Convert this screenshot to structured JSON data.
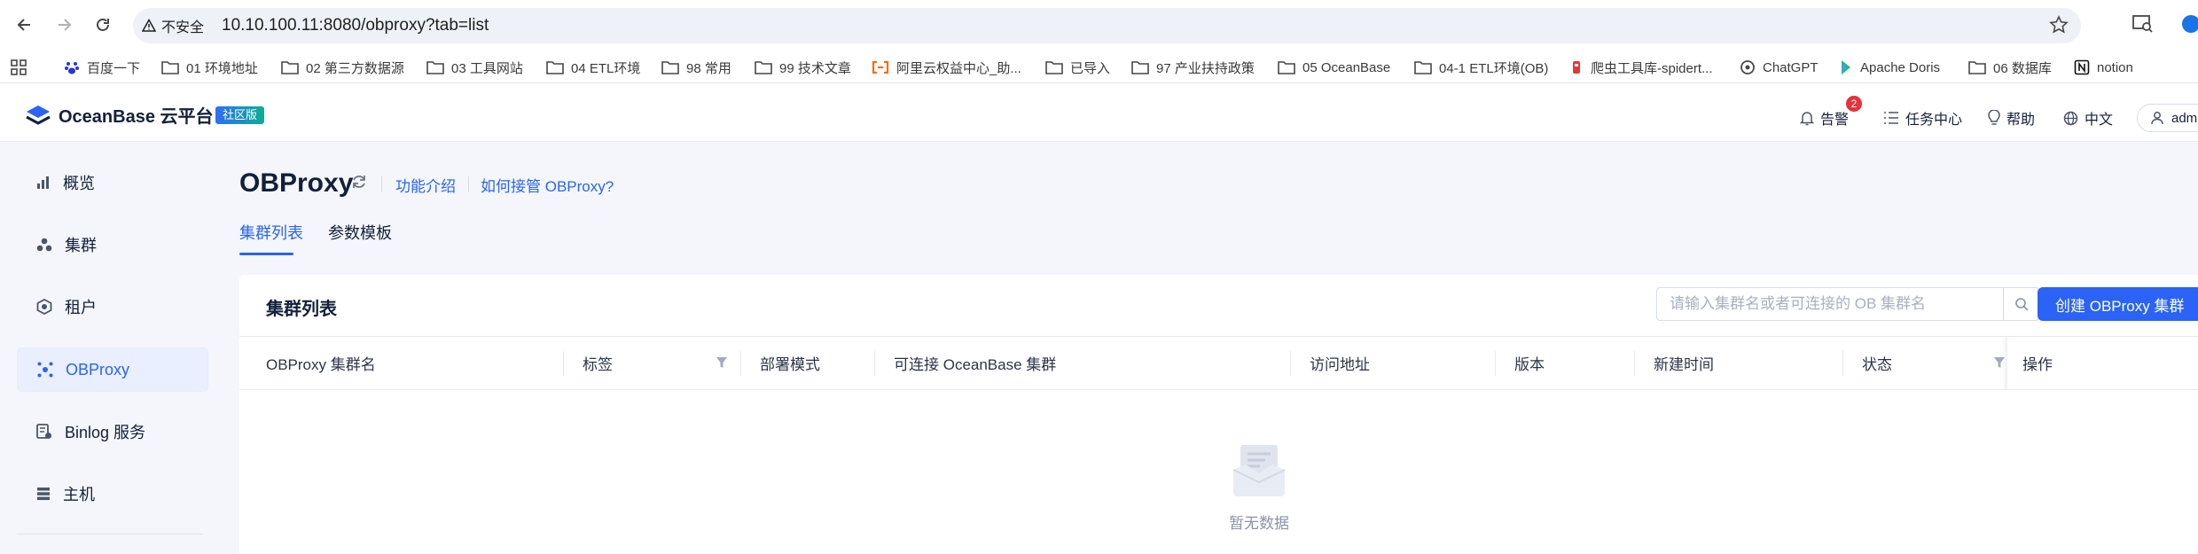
{
  "browser": {
    "security_label": "不安全",
    "url": "10.10.100.11:8080/obproxy?tab=list"
  },
  "bookmarks": [
    {
      "label": "百度一下",
      "icon": "baidu-icon"
    },
    {
      "label": "01 环境地址",
      "icon": "folder-icon"
    },
    {
      "label": "02 第三方数据源",
      "icon": "folder-icon"
    },
    {
      "label": "03 工具网站",
      "icon": "folder-icon"
    },
    {
      "label": "04 ETL环境",
      "icon": "folder-icon"
    },
    {
      "label": "98 常用",
      "icon": "folder-icon"
    },
    {
      "label": "99 技术文章",
      "icon": "folder-icon"
    },
    {
      "label": "阿里云权益中心_助...",
      "icon": "aliyun-icon"
    },
    {
      "label": "已导入",
      "icon": "folder-icon"
    },
    {
      "label": "97 产业扶持政策",
      "icon": "folder-icon"
    },
    {
      "label": "05 OceanBase",
      "icon": "folder-icon"
    },
    {
      "label": "04-1 ETL环境(OB)",
      "icon": "folder-icon"
    },
    {
      "label": "爬虫工具库-spidert...",
      "icon": "spider-icon"
    },
    {
      "label": "ChatGPT",
      "icon": "chatgpt-icon"
    },
    {
      "label": "Apache Doris",
      "icon": "doris-icon"
    },
    {
      "label": "06 数据库",
      "icon": "folder-icon"
    },
    {
      "label": "notion",
      "icon": "notion-icon"
    }
  ],
  "header": {
    "logo_text": "OceanBase 云平台",
    "edition_badge": "社区版",
    "alerts_label": "告警",
    "alerts_count": "2",
    "tasks_label": "任务中心",
    "help_label": "帮助",
    "language_label": "中文",
    "user_label": "admin"
  },
  "sidebar": {
    "items": [
      {
        "label": "概览",
        "icon": "bar-chart-icon"
      },
      {
        "label": "集群",
        "icon": "cluster-icon"
      },
      {
        "label": "租户",
        "icon": "tenant-icon"
      },
      {
        "label": "OBProxy",
        "icon": "obproxy-icon",
        "active": true
      },
      {
        "label": "Binlog 服务",
        "icon": "binlog-icon"
      },
      {
        "label": "主机",
        "icon": "host-icon"
      }
    ]
  },
  "page": {
    "title": "OBProxy",
    "link_intro": "功能介绍",
    "link_howto": "如何接管 OBProxy?",
    "tabs": [
      {
        "label": "集群列表",
        "active": true
      },
      {
        "label": "参数模板",
        "active": false
      }
    ]
  },
  "card": {
    "title": "集群列表",
    "search_placeholder": "请输入集群名或者可连接的 OB 集群名",
    "create_button": "创建 OBProxy 集群",
    "columns": [
      "OBProxy 集群名",
      "标签",
      "部署模式",
      "可连接 OceanBase 集群",
      "访问地址",
      "版本",
      "新建时间",
      "状态",
      "操作"
    ],
    "empty_text": "暂无数据"
  },
  "colors": {
    "primary": "#2a63f5",
    "alert_badge": "#e5323b",
    "edition_badge_start": "#2d6ef5",
    "edition_badge_end": "#0caf92"
  }
}
